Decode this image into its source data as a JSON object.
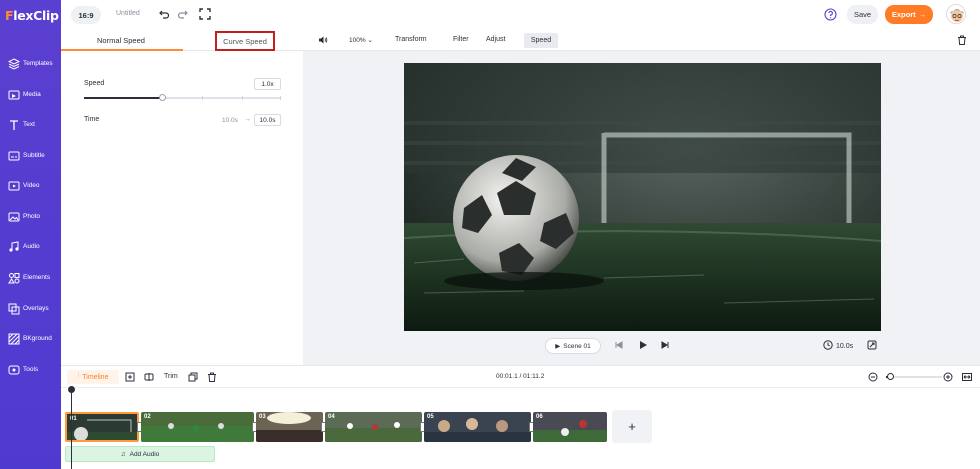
{
  "app": {
    "logo_f": "F",
    "logo_rest": "lexClip"
  },
  "sidebar": {
    "items": [
      {
        "label": "Templates",
        "icon": "templates-icon"
      },
      {
        "label": "Media",
        "icon": "media-icon"
      },
      {
        "label": "Text",
        "icon": "text-icon"
      },
      {
        "label": "Subtitle",
        "icon": "subtitle-icon"
      },
      {
        "label": "Video",
        "icon": "video-icon"
      },
      {
        "label": "Photo",
        "icon": "photo-icon"
      },
      {
        "label": "Audio",
        "icon": "audio-icon"
      },
      {
        "label": "Elements",
        "icon": "elements-icon"
      },
      {
        "label": "Overlays",
        "icon": "overlays-icon"
      },
      {
        "label": "BKground",
        "icon": "background-icon"
      },
      {
        "label": "Tools",
        "icon": "tools-icon"
      }
    ]
  },
  "topbar": {
    "ratio": "16:9",
    "title": "Untitled",
    "save_label": "Save",
    "export_label": "Export",
    "export_arrow": "→"
  },
  "panel": {
    "tab_normal": "Normal Speed",
    "tab_curve": "Curve Speed",
    "speed_label": "Speed",
    "speed_value": "1.0x",
    "speed_fraction": 0.4,
    "time_label": "Time",
    "time_from": "10.0s",
    "time_arrow": "→",
    "time_to": "10.0s"
  },
  "toolbar": {
    "zoom": "100%",
    "transform": "Transform",
    "filter": "Filter",
    "adjust": "Adjust",
    "speed": "Speed"
  },
  "player": {
    "scene_label": "Scene 01",
    "duration": "10.0s"
  },
  "timeline": {
    "tab_label": "Timeline",
    "trim_label": "Trim",
    "time_readout": "00:01.1 / 01:11.2",
    "zoom_fraction": 0.08,
    "clips": [
      "01",
      "02",
      "03",
      "04",
      "05",
      "06"
    ],
    "add_scene": "+",
    "add_audio": "Add Audio"
  },
  "colors": {
    "sidebar": "#5b3fd0",
    "accent": "#ff7b26",
    "highlight_box": "#c0211f",
    "audio_track": "#dcf5e3"
  }
}
